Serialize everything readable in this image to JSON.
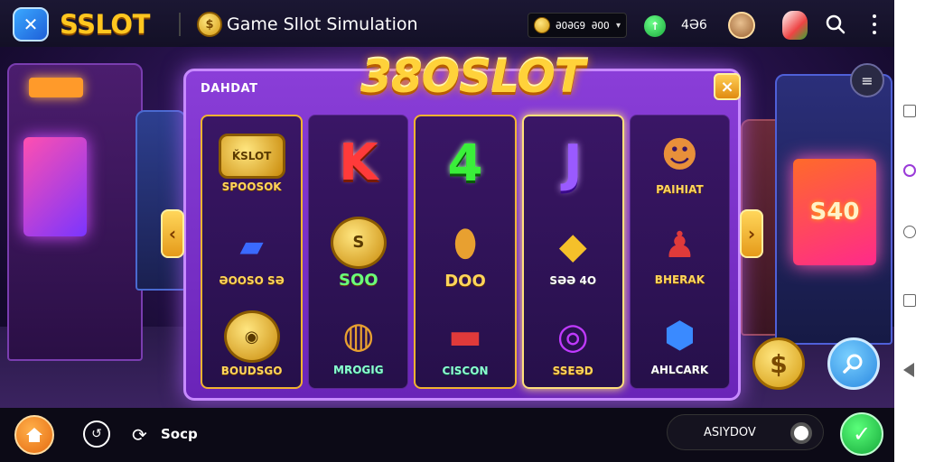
{
  "topbar": {
    "brand": "SSLOT",
    "page_title": "Game Sllot Simulation",
    "balance": "ƏOƏG9 ƏOO",
    "gems": "4Ə6"
  },
  "modal": {
    "logo": "38OSLOT",
    "label": "DAHDAT",
    "close": "×"
  },
  "reels": [
    [
      {
        "symbol": "ǨSLOT",
        "label": "SPOOSOK"
      },
      {
        "symbol": "",
        "label": "ƏOOSO SƏ"
      },
      {
        "symbol": "◉",
        "label": "BOUDSGO"
      }
    ],
    [
      {
        "symbol": "K",
        "label": ""
      },
      {
        "symbol": "S",
        "label": "SOO"
      },
      {
        "symbol": "",
        "label": "MROGIG"
      }
    ],
    [
      {
        "symbol": "4",
        "label": ""
      },
      {
        "symbol": "",
        "label": "DOO"
      },
      {
        "symbol": "",
        "label": "CISCON"
      }
    ],
    [
      {
        "symbol": "J",
        "label": ""
      },
      {
        "symbol": "",
        "label": "SƏƏ 4O"
      },
      {
        "symbol": "",
        "label": "SSEƏD"
      }
    ],
    [
      {
        "symbol": "",
        "label": "PAIHIAT"
      },
      {
        "symbol": "",
        "label": "BHERAK"
      },
      {
        "symbol": "",
        "label": "AHLCARK"
      }
    ]
  ],
  "cabinet_display": "S40",
  "bottombar": {
    "sync_label": "Socp",
    "input_text": "ASIYDOV"
  },
  "colors": {
    "brand": "#ffc61f",
    "modal": "#7a30c8",
    "accent_gold": "#ffd23a"
  },
  "icons": {
    "logo": "app-logo-icon",
    "search": "search-icon",
    "more": "more-vert-icon",
    "home": "home-icon",
    "timer": "timer-icon",
    "sync": "sync-icon",
    "go": "check-icon"
  }
}
